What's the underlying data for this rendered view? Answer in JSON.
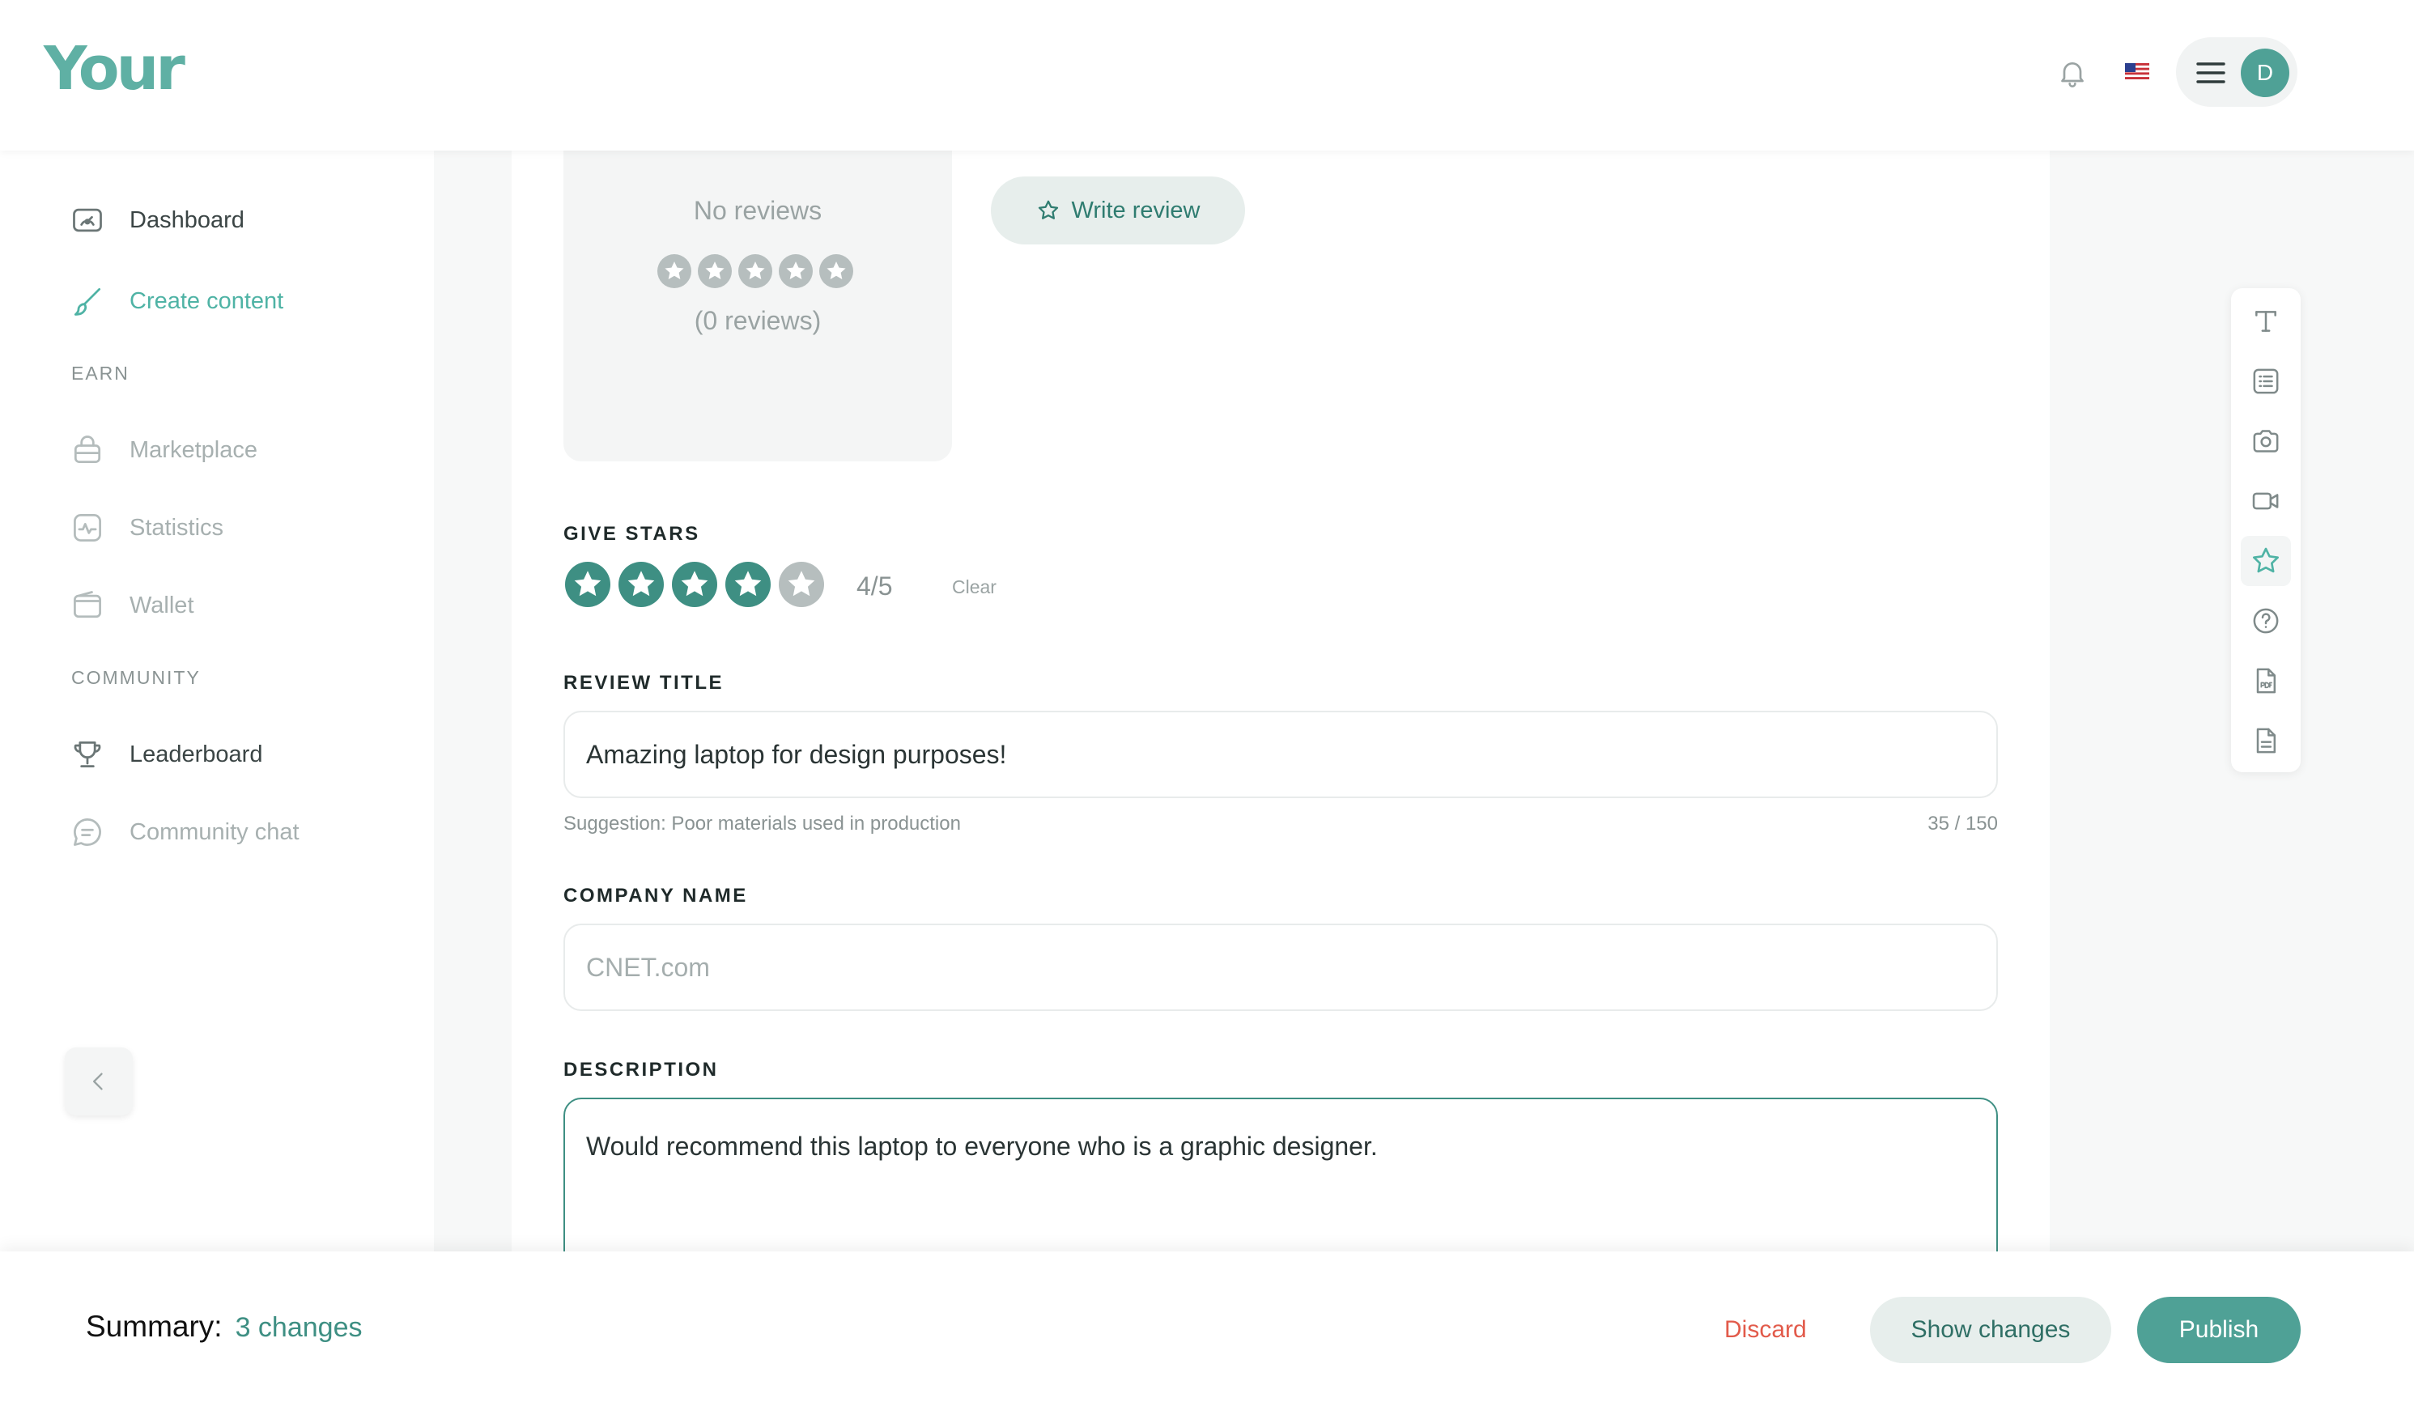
{
  "brand": {
    "logo_text": "Your",
    "accent": "#5fb0a4",
    "primary": "#4fa196"
  },
  "header": {
    "avatar_initial": "D",
    "flag": "flag-us-icon",
    "bell": "bell-icon",
    "menu": "hamburger-icon"
  },
  "sidebar": {
    "items_top": [
      {
        "label": "Dashboard",
        "icon": "dashboard-icon",
        "state": "default"
      },
      {
        "label": "Create content",
        "icon": "brush-icon",
        "state": "active"
      }
    ],
    "section_earn": "EARN",
    "items_earn": [
      {
        "label": "Marketplace",
        "icon": "basket-icon",
        "state": "muted"
      },
      {
        "label": "Statistics",
        "icon": "pulse-icon",
        "state": "muted"
      },
      {
        "label": "Wallet",
        "icon": "wallet-icon",
        "state": "muted"
      }
    ],
    "section_community": "COMMUNITY",
    "items_community": [
      {
        "label": "Leaderboard",
        "icon": "trophy-icon",
        "state": "default"
      },
      {
        "label": "Community chat",
        "icon": "chat-icon",
        "state": "muted"
      }
    ],
    "collapse_icon": "chevron-left-icon"
  },
  "rating_card": {
    "title": "No reviews",
    "stars": 0,
    "max_stars": 5,
    "count_text": "(0 reviews)"
  },
  "write_review": {
    "label": "Write review",
    "icon": "star-outline-icon"
  },
  "give_stars": {
    "label": "GIVE STARS",
    "rating": 4,
    "max": 5,
    "value_text": "4/5",
    "clear_label": "Clear"
  },
  "review_title": {
    "label": "REVIEW TITLE",
    "value": "Amazing laptop for design purposes!",
    "suggestion": "Suggestion: Poor materials used in production",
    "counter": "35 / 150"
  },
  "company_name": {
    "label": "COMPANY NAME",
    "placeholder": "CNET.com"
  },
  "description": {
    "label": "DESCRIPTION",
    "value": "Would recommend this laptop to everyone who is a graphic designer."
  },
  "toolbar": {
    "tools": [
      "text-icon",
      "list-icon",
      "camera-icon",
      "video-icon",
      "star-icon",
      "question-icon",
      "pdf-icon",
      "document-icon"
    ],
    "active": "star-icon"
  },
  "bottom_bar": {
    "summary_label": "Summary:",
    "summary_changes": "3 changes",
    "discard_label": "Discard",
    "show_changes_label": "Show changes",
    "publish_label": "Publish"
  }
}
